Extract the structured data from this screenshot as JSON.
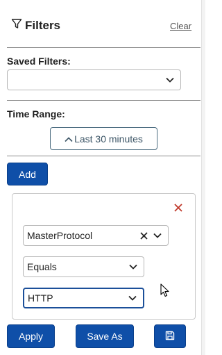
{
  "header": {
    "title": "Filters",
    "clear_label": "Clear"
  },
  "saved_filters": {
    "label": "Saved Filters:",
    "selected": ""
  },
  "time_range": {
    "label": "Time Range:",
    "button_label": "Last 30 minutes"
  },
  "add_label": "Add",
  "filter": {
    "field": "MasterProtocol",
    "operator": "Equals",
    "value": "HTTP"
  },
  "footer": {
    "apply_label": "Apply",
    "save_as_label": "Save As"
  },
  "colors": {
    "primary": "#0f4fa8",
    "remove": "#c0392b"
  },
  "icons": [
    "filter-icon",
    "chevron-down-icon",
    "chevron-up-icon",
    "close-icon",
    "clear-selection-icon",
    "save-icon",
    "mouse-cursor-icon"
  ]
}
